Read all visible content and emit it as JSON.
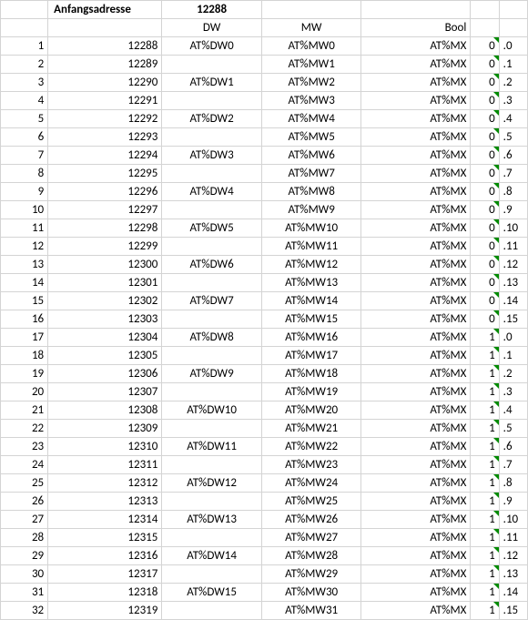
{
  "headers": {
    "addr_label": "Anfangsadresse",
    "addr_value": "12288",
    "dw": "DW",
    "mw": "MW",
    "bool": "Bool"
  },
  "rows": [
    {
      "i": "1",
      "addr": "12288",
      "dw": "AT%DW0",
      "mw": "AT%MW0",
      "bool": "AT%MX",
      "b1": "0",
      "b2": ".0"
    },
    {
      "i": "2",
      "addr": "12289",
      "dw": "",
      "mw": "AT%MW1",
      "bool": "AT%MX",
      "b1": "0",
      "b2": ".1"
    },
    {
      "i": "3",
      "addr": "12290",
      "dw": "AT%DW1",
      "mw": "AT%MW2",
      "bool": "AT%MX",
      "b1": "0",
      "b2": ".2"
    },
    {
      "i": "4",
      "addr": "12291",
      "dw": "",
      "mw": "AT%MW3",
      "bool": "AT%MX",
      "b1": "0",
      "b2": ".3"
    },
    {
      "i": "5",
      "addr": "12292",
      "dw": "AT%DW2",
      "mw": "AT%MW4",
      "bool": "AT%MX",
      "b1": "0",
      "b2": ".4"
    },
    {
      "i": "6",
      "addr": "12293",
      "dw": "",
      "mw": "AT%MW5",
      "bool": "AT%MX",
      "b1": "0",
      "b2": ".5"
    },
    {
      "i": "7",
      "addr": "12294",
      "dw": "AT%DW3",
      "mw": "AT%MW6",
      "bool": "AT%MX",
      "b1": "0",
      "b2": ".6"
    },
    {
      "i": "8",
      "addr": "12295",
      "dw": "",
      "mw": "AT%MW7",
      "bool": "AT%MX",
      "b1": "0",
      "b2": ".7"
    },
    {
      "i": "9",
      "addr": "12296",
      "dw": "AT%DW4",
      "mw": "AT%MW8",
      "bool": "AT%MX",
      "b1": "0",
      "b2": ".8"
    },
    {
      "i": "10",
      "addr": "12297",
      "dw": "",
      "mw": "AT%MW9",
      "bool": "AT%MX",
      "b1": "0",
      "b2": ".9"
    },
    {
      "i": "11",
      "addr": "12298",
      "dw": "AT%DW5",
      "mw": "AT%MW10",
      "bool": "AT%MX",
      "b1": "0",
      "b2": ".10"
    },
    {
      "i": "12",
      "addr": "12299",
      "dw": "",
      "mw": "AT%MW11",
      "bool": "AT%MX",
      "b1": "0",
      "b2": ".11"
    },
    {
      "i": "13",
      "addr": "12300",
      "dw": "AT%DW6",
      "mw": "AT%MW12",
      "bool": "AT%MX",
      "b1": "0",
      "b2": ".12"
    },
    {
      "i": "14",
      "addr": "12301",
      "dw": "",
      "mw": "AT%MW13",
      "bool": "AT%MX",
      "b1": "0",
      "b2": ".13"
    },
    {
      "i": "15",
      "addr": "12302",
      "dw": "AT%DW7",
      "mw": "AT%MW14",
      "bool": "AT%MX",
      "b1": "0",
      "b2": ".14"
    },
    {
      "i": "16",
      "addr": "12303",
      "dw": "",
      "mw": "AT%MW15",
      "bool": "AT%MX",
      "b1": "0",
      "b2": ".15"
    },
    {
      "i": "17",
      "addr": "12304",
      "dw": "AT%DW8",
      "mw": "AT%MW16",
      "bool": "AT%MX",
      "b1": "1",
      "b2": ".0"
    },
    {
      "i": "18",
      "addr": "12305",
      "dw": "",
      "mw": "AT%MW17",
      "bool": "AT%MX",
      "b1": "1",
      "b2": ".1"
    },
    {
      "i": "19",
      "addr": "12306",
      "dw": "AT%DW9",
      "mw": "AT%MW18",
      "bool": "AT%MX",
      "b1": "1",
      "b2": ".2"
    },
    {
      "i": "20",
      "addr": "12307",
      "dw": "",
      "mw": "AT%MW19",
      "bool": "AT%MX",
      "b1": "1",
      "b2": ".3"
    },
    {
      "i": "21",
      "addr": "12308",
      "dw": "AT%DW10",
      "mw": "AT%MW20",
      "bool": "AT%MX",
      "b1": "1",
      "b2": ".4"
    },
    {
      "i": "22",
      "addr": "12309",
      "dw": "",
      "mw": "AT%MW21",
      "bool": "AT%MX",
      "b1": "1",
      "b2": ".5"
    },
    {
      "i": "23",
      "addr": "12310",
      "dw": "AT%DW11",
      "mw": "AT%MW22",
      "bool": "AT%MX",
      "b1": "1",
      "b2": ".6"
    },
    {
      "i": "24",
      "addr": "12311",
      "dw": "",
      "mw": "AT%MW23",
      "bool": "AT%MX",
      "b1": "1",
      "b2": ".7"
    },
    {
      "i": "25",
      "addr": "12312",
      "dw": "AT%DW12",
      "mw": "AT%MW24",
      "bool": "AT%MX",
      "b1": "1",
      "b2": ".8"
    },
    {
      "i": "26",
      "addr": "12313",
      "dw": "",
      "mw": "AT%MW25",
      "bool": "AT%MX",
      "b1": "1",
      "b2": ".9"
    },
    {
      "i": "27",
      "addr": "12314",
      "dw": "AT%DW13",
      "mw": "AT%MW26",
      "bool": "AT%MX",
      "b1": "1",
      "b2": ".10"
    },
    {
      "i": "28",
      "addr": "12315",
      "dw": "",
      "mw": "AT%MW27",
      "bool": "AT%MX",
      "b1": "1",
      "b2": ".11"
    },
    {
      "i": "29",
      "addr": "12316",
      "dw": "AT%DW14",
      "mw": "AT%MW28",
      "bool": "AT%MX",
      "b1": "1",
      "b2": ".12"
    },
    {
      "i": "30",
      "addr": "12317",
      "dw": "",
      "mw": "AT%MW29",
      "bool": "AT%MX",
      "b1": "1",
      "b2": ".13"
    },
    {
      "i": "31",
      "addr": "12318",
      "dw": "AT%DW15",
      "mw": "AT%MW30",
      "bool": "AT%MX",
      "b1": "1",
      "b2": ".14"
    },
    {
      "i": "32",
      "addr": "12319",
      "dw": "",
      "mw": "AT%MW31",
      "bool": "AT%MX",
      "b1": "1",
      "b2": ".15"
    }
  ]
}
